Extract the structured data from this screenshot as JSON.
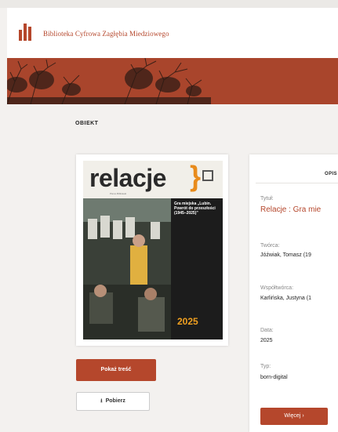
{
  "header": {
    "site_name": "Biblioteka Cyfrowa Zagłębia Miedziowego"
  },
  "section": {
    "label": "OBIEKT"
  },
  "cover": {
    "magazine_title": "relacje",
    "brace": "}",
    "subtitle": "Pismo Biblioteki",
    "headline": "Gra miejska „Lubin. Powrót do przeszłości (1945–2025)”",
    "year": "2025"
  },
  "actions": {
    "show_content": "Pokaż treść",
    "download": "Pobierz",
    "more": "Więcej"
  },
  "description": {
    "heading": "OPIS",
    "fields": [
      {
        "label": "Tytuł:",
        "value": "Relacje : Gra mie"
      },
      {
        "label": "Twórca:",
        "value": "Jóźwiak, Tomasz (19"
      },
      {
        "label": "Współtwórca:",
        "value": "Karlińska, Justyna (1"
      },
      {
        "label": "Data:",
        "value": "2025"
      },
      {
        "label": "Typ:",
        "value": "born-digital"
      }
    ]
  },
  "colors": {
    "accent": "#b5472c",
    "background": "#f3f1ef"
  }
}
